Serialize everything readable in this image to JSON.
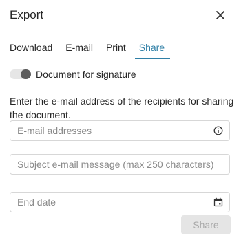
{
  "dialog": {
    "title": "Export"
  },
  "tabs": [
    {
      "label": "Download",
      "active": false
    },
    {
      "label": "E-mail",
      "active": false
    },
    {
      "label": "Print",
      "active": false
    },
    {
      "label": "Share",
      "active": true
    }
  ],
  "toggle": {
    "label": "Document for signature",
    "checked": true
  },
  "description": "Enter the e-mail address of the recipients for sharing the document.",
  "fields": {
    "emails": {
      "value": "",
      "placeholder": "E-mail addresses",
      "icon": "info-icon"
    },
    "subject": {
      "value": "",
      "placeholder": "Subject e-mail message (max 250 characters)"
    },
    "end_date": {
      "value": "",
      "placeholder": "End date",
      "icon": "calendar-icon"
    }
  },
  "actions": {
    "share_label": "Share",
    "share_enabled": false
  },
  "colors": {
    "accent": "#2f7fa6",
    "disabled_bg": "#e5e5e5",
    "disabled_text": "#a9a9a9"
  }
}
